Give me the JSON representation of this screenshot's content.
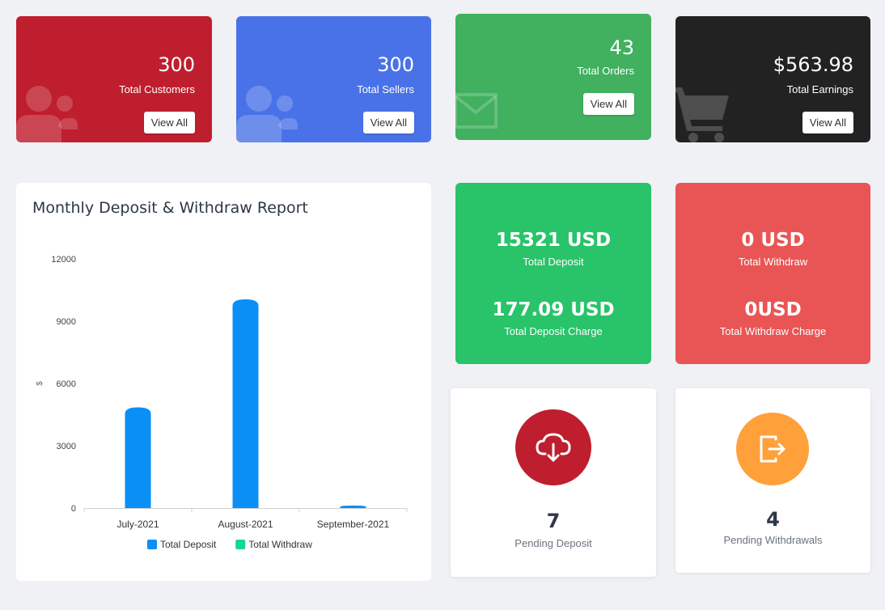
{
  "stats": [
    {
      "value": "300",
      "label": "Total Customers",
      "button": "View All",
      "icon": "users-icon",
      "color": "#bf1e2e"
    },
    {
      "value": "300",
      "label": "Total Sellers",
      "button": "View All",
      "icon": "users-icon",
      "color": "#4a72e8"
    },
    {
      "value": "43",
      "label": "Total Orders",
      "button": "View All",
      "icon": "envelope-icon",
      "color": "#41b05f"
    },
    {
      "value": "$563.98",
      "label": "Total Earnings",
      "button": "View All",
      "icon": "cart-icon",
      "color": "#222222"
    }
  ],
  "deposit_box": {
    "total": "15321 USD",
    "total_label": "Total Deposit",
    "charge": "177.09 USD",
    "charge_label": "Total Deposit Charge",
    "color": "#29c36a"
  },
  "withdraw_box": {
    "total": "0 USD",
    "total_label": "Total Withdraw",
    "charge": "0USD",
    "charge_label": "Total Withdraw Charge",
    "color": "#e95555"
  },
  "pending": [
    {
      "value": "7",
      "label": "Pending Deposit",
      "icon": "cloud-download-icon",
      "color": "#bf1e2e"
    },
    {
      "value": "4",
      "label": "Pending Withdrawals",
      "icon": "sign-out-icon",
      "color": "#ffa03a"
    }
  ],
  "chart": {
    "title": "Monthly Deposit & Withdraw Report"
  },
  "chart_data": {
    "type": "bar",
    "categories": [
      "July-2021",
      "August-2021",
      "September-2021"
    ],
    "series": [
      {
        "name": "Total Deposit",
        "values": [
          4850,
          10050,
          120
        ],
        "color": "#0a8ff7"
      },
      {
        "name": "Total Withdraw",
        "values": [
          0,
          0,
          0
        ],
        "color": "#17d59a"
      }
    ],
    "ylabel": "$",
    "ylim": [
      0,
      12000
    ],
    "yticks": [
      "0",
      "3000",
      "6000",
      "9000",
      "12000"
    ],
    "legend": "bottom"
  }
}
